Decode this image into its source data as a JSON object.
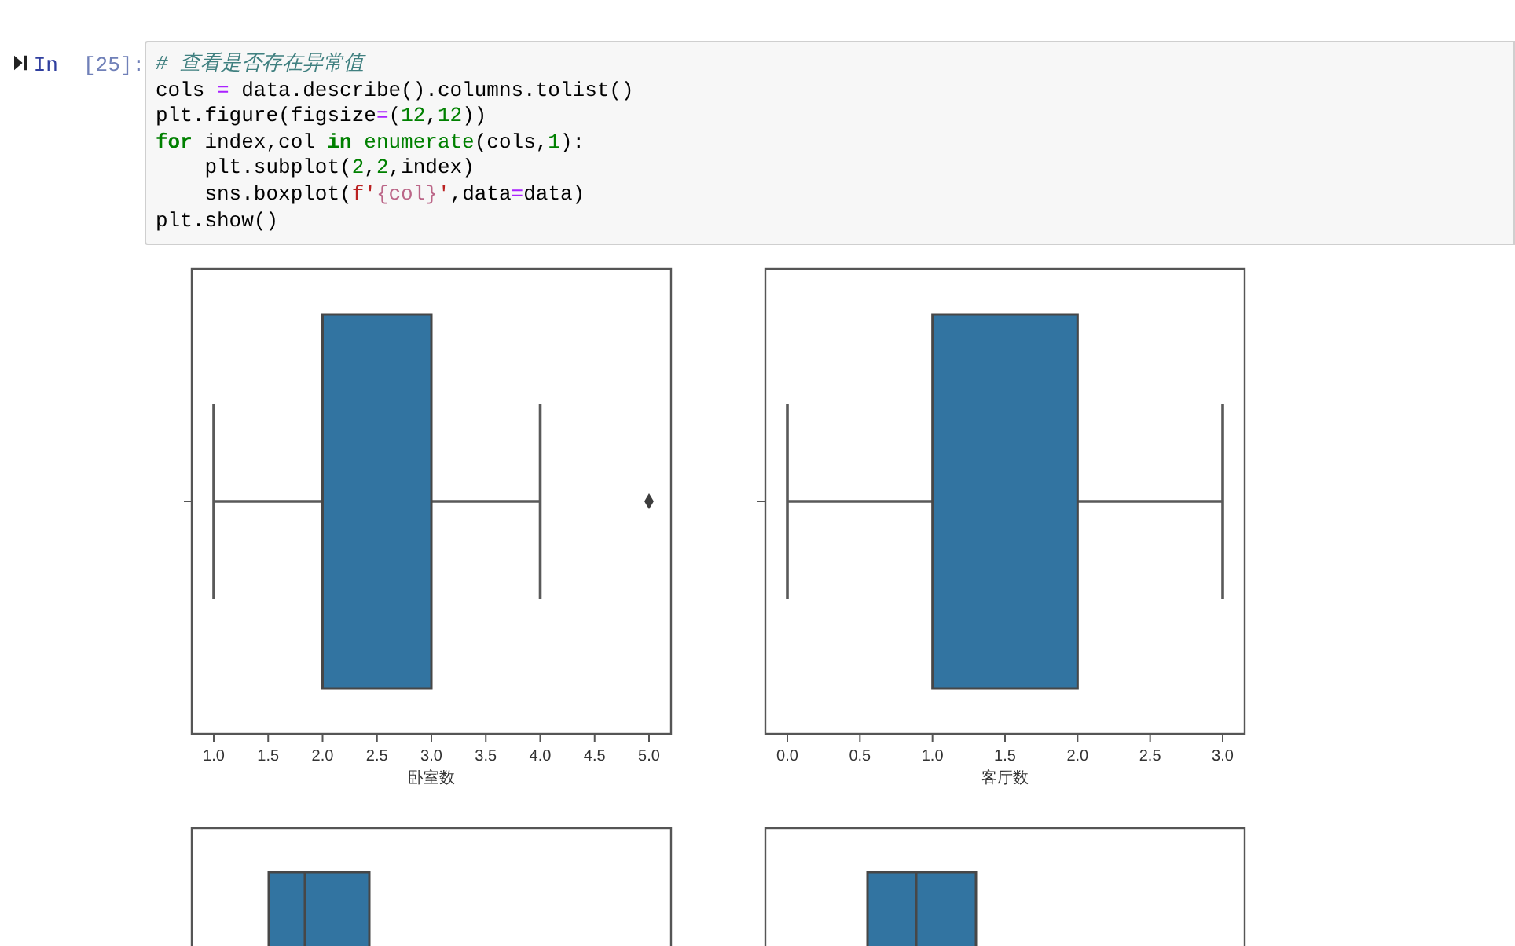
{
  "cell": {
    "prompt_label": "In",
    "prompt_number": "[25]:",
    "code_lines": [
      [
        {
          "kind": "comment",
          "text": "# 查看是否存在异常值"
        }
      ],
      [
        {
          "kind": "plain",
          "text": "cols "
        },
        {
          "kind": "op",
          "text": "="
        },
        {
          "kind": "plain",
          "text": " data.describe().columns.tolist()"
        }
      ],
      [
        {
          "kind": "plain",
          "text": "plt.figure(figsize"
        },
        {
          "kind": "op",
          "text": "="
        },
        {
          "kind": "plain",
          "text": "("
        },
        {
          "kind": "num",
          "text": "12"
        },
        {
          "kind": "plain",
          "text": ","
        },
        {
          "kind": "num",
          "text": "12"
        },
        {
          "kind": "plain",
          "text": "))"
        }
      ],
      [
        {
          "kind": "kw",
          "text": "for"
        },
        {
          "kind": "plain",
          "text": " index,col "
        },
        {
          "kind": "kw",
          "text": "in"
        },
        {
          "kind": "builtin",
          "text": " enumerate"
        },
        {
          "kind": "plain",
          "text": "(cols,"
        },
        {
          "kind": "num",
          "text": "1"
        },
        {
          "kind": "plain",
          "text": "):"
        }
      ],
      [
        {
          "kind": "plain",
          "text": "    plt.subplot("
        },
        {
          "kind": "num",
          "text": "2"
        },
        {
          "kind": "plain",
          "text": ","
        },
        {
          "kind": "num",
          "text": "2"
        },
        {
          "kind": "plain",
          "text": ",index)"
        }
      ],
      [
        {
          "kind": "plain",
          "text": "    sns.boxplot("
        },
        {
          "kind": "str",
          "text": "f'"
        },
        {
          "kind": "interp",
          "text": "{col}"
        },
        {
          "kind": "str",
          "text": "'"
        },
        {
          "kind": "plain",
          "text": ",data"
        },
        {
          "kind": "op",
          "text": "="
        },
        {
          "kind": "plain",
          "text": "data)"
        }
      ],
      [
        {
          "kind": "plain",
          "text": "plt.show()"
        }
      ]
    ]
  },
  "figures": [
    {
      "kind": "box",
      "xticks": [
        "1.0",
        "1.5",
        "2.0",
        "2.5",
        "3.0",
        "3.5",
        "4.0",
        "4.5",
        "5.0"
      ],
      "xlabel": "卧室数"
    },
    {
      "kind": "box",
      "xticks": [
        "0.0",
        "0.5",
        "1.0",
        "1.5",
        "2.0",
        "2.5",
        "3.0"
      ],
      "xlabel": "客厅数"
    },
    {
      "kind": "box"
    },
    {
      "kind": "box"
    }
  ]
}
